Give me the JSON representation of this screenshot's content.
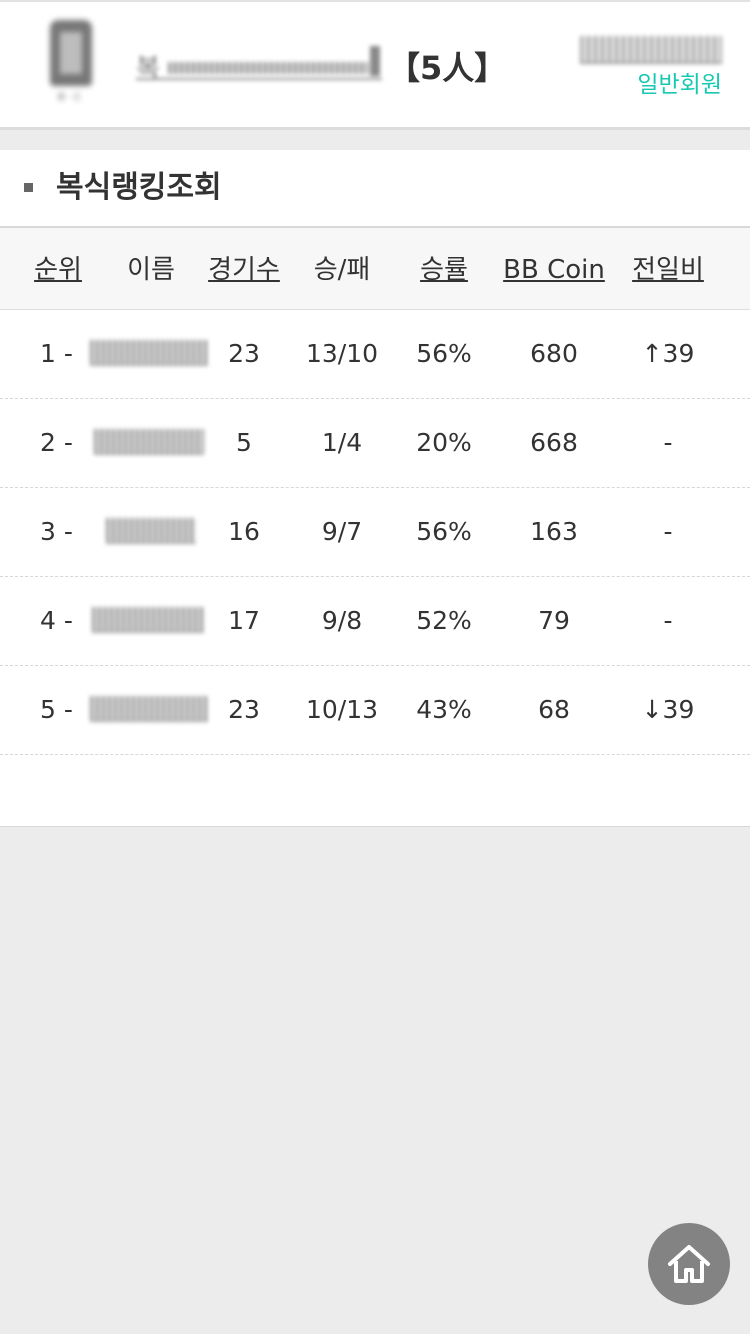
{
  "header": {
    "club_name_first": "복",
    "member_count": "【5人】",
    "member_type": "일반회원",
    "logo_text": "B·C"
  },
  "section": {
    "title": "복식랭킹조회"
  },
  "table": {
    "columns": [
      "순위",
      "이름",
      "경기수",
      "승/패",
      "승률",
      "BB Coin",
      "전일비"
    ],
    "rows": [
      {
        "rank": "1 -",
        "games": "23",
        "win_loss": "13/10",
        "rate": "56%",
        "coin": "680",
        "diff": "↑39"
      },
      {
        "rank": "2 -",
        "games": "5",
        "win_loss": "1/4",
        "rate": "20%",
        "coin": "668",
        "diff": "-"
      },
      {
        "rank": "3 -",
        "games": "16",
        "win_loss": "9/7",
        "rate": "56%",
        "coin": "163",
        "diff": "-"
      },
      {
        "rank": "4 -",
        "games": "17",
        "win_loss": "9/8",
        "rate": "52%",
        "coin": "79",
        "diff": "-"
      },
      {
        "rank": "5 -",
        "games": "23",
        "win_loss": "10/13",
        "rate": "43%",
        "coin": "68",
        "diff": "↓39"
      }
    ]
  },
  "icons": {
    "home": "home-icon"
  },
  "colors": {
    "member_type": "#18c9b2",
    "diff_up": "#ef3f3f",
    "home_button": "#838383"
  }
}
